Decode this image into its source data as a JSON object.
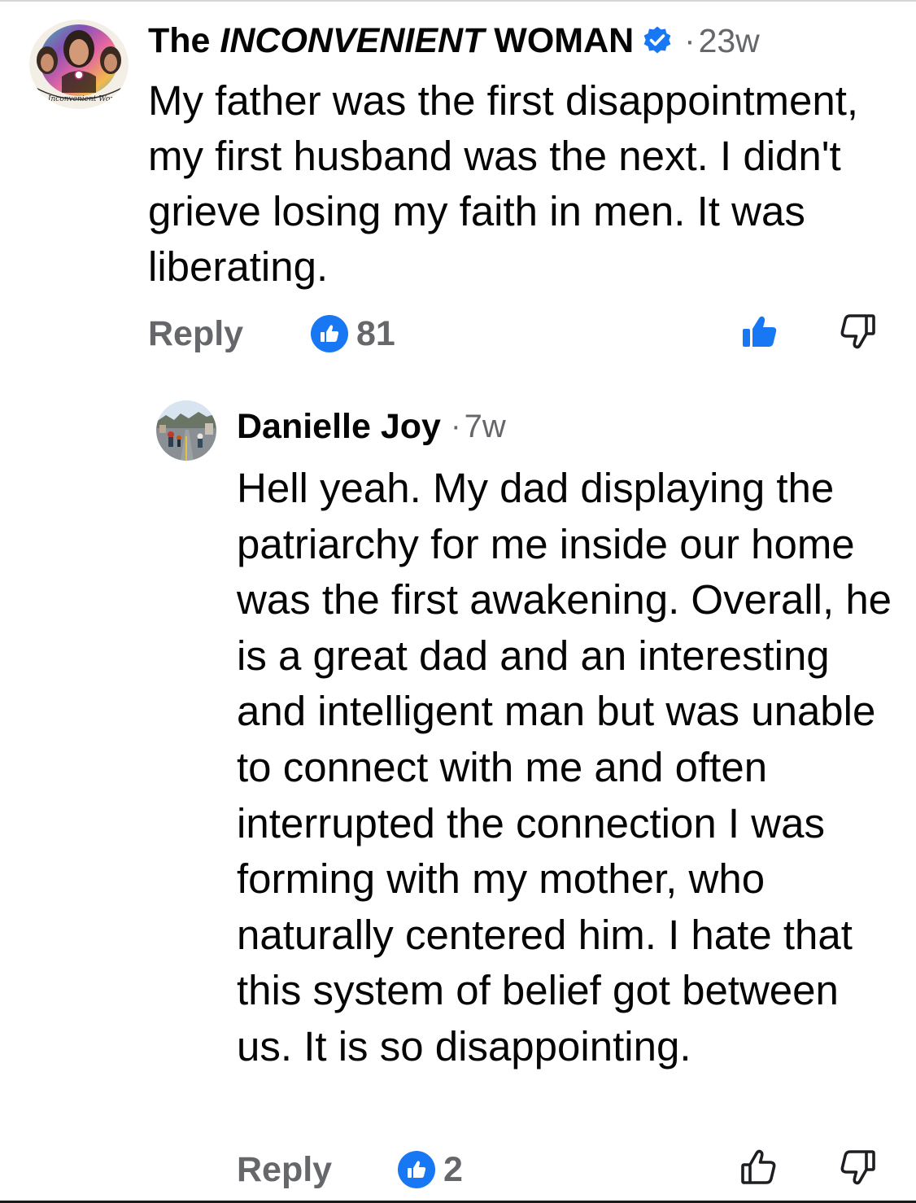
{
  "colors": {
    "primary_text": "#050505",
    "secondary_text": "#65676b",
    "accent_blue": "#1877f2"
  },
  "comment": {
    "author_prefix": "The ",
    "author_emphasis": "INCONVENIENT",
    "author_suffix": " WOMAN",
    "verified_icon": "verified-badge-icon",
    "separator": "·",
    "time": "23w",
    "text": "My father was the first disappointment, my first husband was the next. I didn't grieve losing my faith in men. It was liberating.",
    "reply_label": "Reply",
    "reaction_icon": "like-reaction-icon",
    "reaction_count": "81",
    "like_icon": "thumbs-up-filled-icon",
    "like_active": true,
    "dislike_icon": "thumbs-down-icon",
    "avatar_logo_text": "The Inconvenient Woman"
  },
  "reply": {
    "author": "Danielle Joy",
    "separator": "·",
    "time": "7w",
    "text": "Hell yeah.  My dad displaying the patriarchy for me inside our home was the first awakening. Overall, he is a great dad and an interesting and intelligent man but was unable to connect with me and often interrupted the connection I was forming with my mother, who naturally centered him.  I hate that this system of belief got between us.  It is so disappointing.",
    "reply_label": "Reply",
    "reaction_icon": "like-reaction-icon",
    "reaction_count": "2",
    "like_icon": "thumbs-up-outline-icon",
    "like_active": false,
    "dislike_icon": "thumbs-down-icon"
  }
}
